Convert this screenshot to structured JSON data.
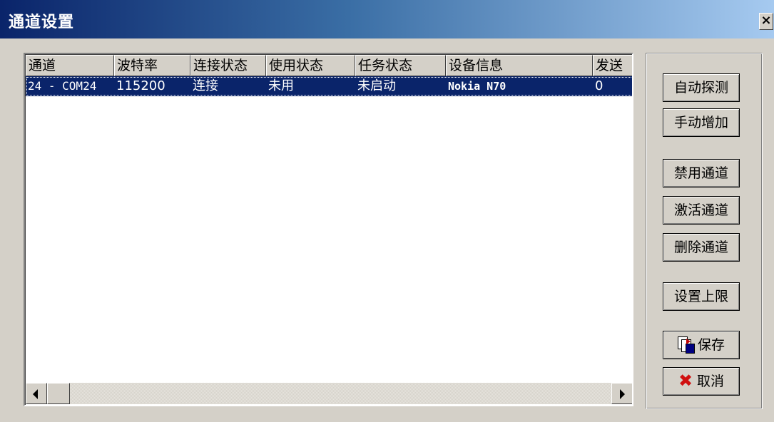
{
  "window": {
    "title": "通道设置",
    "close_glyph": "×"
  },
  "list": {
    "columns": [
      "通道",
      "波特率",
      "连接状态",
      "使用状态",
      "任务状态",
      "设备信息",
      "发送"
    ],
    "rows": [
      {
        "channel": "24 - COM24",
        "baud": "115200",
        "connection": "连接",
        "usage": "未用",
        "task": "未启动",
        "device": "Nokia N70",
        "send": "0"
      }
    ]
  },
  "buttons": {
    "auto_detect": "自动探测",
    "manual_add": "手动增加",
    "disable_channel": "禁用通道",
    "activate_channel": "激活通道",
    "delete_channel": "删除通道",
    "set_limit": "设置上限",
    "save": "保存",
    "cancel": "取消"
  },
  "icons": {
    "save": "save-icon",
    "cancel": "cancel-x-icon",
    "scroll_left": "arrow-left-icon",
    "scroll_right": "arrow-right-icon"
  },
  "colors": {
    "title_bar_start": "#0a246a",
    "title_bar_end": "#a6caf0",
    "selection": "#0a246a",
    "face": "#d4d0c8",
    "cancel_icon": "#d01010"
  }
}
